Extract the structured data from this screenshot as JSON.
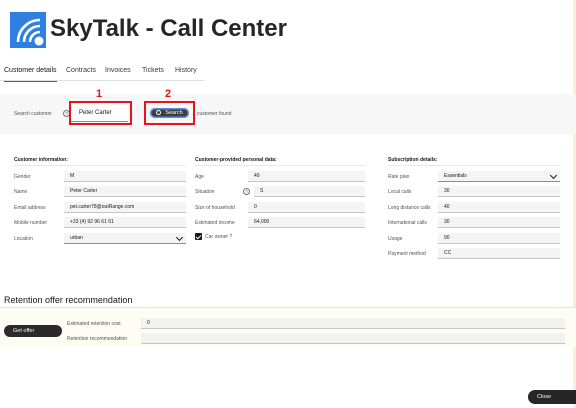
{
  "header": {
    "title": "SkyTalk - Call Center",
    "logo_icon": "concentric-circles-logo-icon"
  },
  "tabs": [
    {
      "label": "Customer details",
      "active": true
    },
    {
      "label": "Contracts",
      "active": false
    },
    {
      "label": "Invoices",
      "active": false
    },
    {
      "label": "Tickets",
      "active": false
    },
    {
      "label": "History",
      "active": false
    }
  ],
  "search": {
    "label": "Search customer",
    "value": "Peter Carter",
    "button_label": "Search",
    "status": "customer found"
  },
  "annotations": {
    "first": "1",
    "second": "2",
    "color": "#e8111c"
  },
  "customer_info": {
    "title": "Customer information:",
    "fields": [
      {
        "label": "Gender",
        "value": "M"
      },
      {
        "label": "Name",
        "value": "Peter Carter"
      },
      {
        "label": "Email address",
        "value": "pet.carter78@outRange.com"
      },
      {
        "label": "Mobile number",
        "value": "+33 (4) 92 96 61 61"
      },
      {
        "label": "Location",
        "value": "urban"
      }
    ]
  },
  "personal_data": {
    "title": "Customer-provided personal data:",
    "fields": [
      {
        "label": "Age",
        "value": "49"
      },
      {
        "label": "Situation",
        "value": "S"
      },
      {
        "label": "Size of household",
        "value": "0"
      },
      {
        "label": "Estimated income",
        "value": "64,000"
      }
    ],
    "car_owner_label": "Car owner ?",
    "car_owner_checked": true
  },
  "subscription": {
    "title": "Subscription details:",
    "fields": [
      {
        "label": "Rate plan",
        "value": "Essentials"
      },
      {
        "label": "Local calls",
        "value": "30"
      },
      {
        "label": "Long distance calls",
        "value": "40"
      },
      {
        "label": "International calls",
        "value": "30"
      },
      {
        "label": "Usage",
        "value": "90"
      },
      {
        "label": "Payment method",
        "value": "CC"
      }
    ]
  },
  "retention": {
    "title": "Retention offer recommendation",
    "button_label": "Get offer",
    "cost_label": "Estimated retention cost",
    "cost_value": "0",
    "recommendation_label": "Retention recommendation",
    "recommendation_value": ""
  },
  "footer": {
    "close_label": "Close"
  },
  "colors": {
    "accent": "#0f62fe",
    "logo": "#2f7fe0",
    "annotation": "#e8111c"
  }
}
